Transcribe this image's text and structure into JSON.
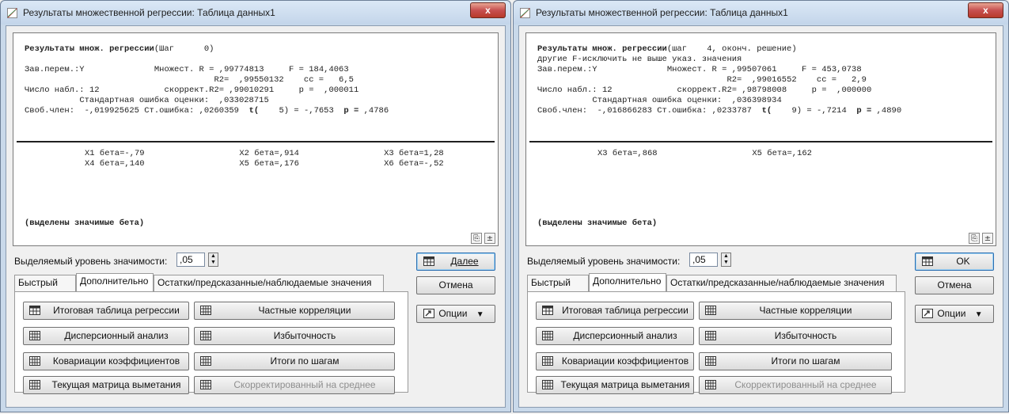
{
  "windows": [
    {
      "title": "Результаты множественной регрессии: Таблица данных1",
      "close_label": "x",
      "results": {
        "header_bold": "Результаты множ. регрессии",
        "header_rest": "(Шаг      0)",
        "header_line2": "",
        "dep_var_label": "Зав.перем.:Y",
        "mult_r_label": "Множест. R =",
        "mult_r_value": ",99774813",
        "f_label": "F =",
        "f_value": "184,4063",
        "r2_label": "R2=",
        "r2_value": ",99550132",
        "cc_label": "cc =",
        "cc_value": "6,5",
        "n_label": "Число набл.:",
        "n_value": "12",
        "adj_r2_label": "скоррект.R2=",
        "adj_r2_value": ",99010291",
        "p_label": "p =",
        "p_value": ",000011",
        "std_err_label": "Стандартная ошибка оценки:",
        "std_err_value": ",033028715",
        "intercept_label": "Своб.член:",
        "intercept_value": "-,019925625",
        "intercept_se_label": "Ст.ошибка:",
        "intercept_se_value": ",0260359",
        "t_label": "t(",
        "t_df": "5)",
        "t_value": "= -,7653",
        "t_p_label": "p =",
        "t_p_value": ",4786",
        "betas": [
          "X1 бета=-,79",
          "X2 бета=,914",
          "X3 бета=1,28",
          "X4 бета=,140",
          "X5 бета=,176",
          "X6 бета=-,52"
        ],
        "sig_note": "(выделены значимые бета)"
      },
      "level_label": "Выделяемый уровень значимости:",
      "level_value": ",05",
      "tabs": [
        "Быстрый",
        "Дополнительно",
        "Остатки/предсказанные/наблюдаемые значения"
      ],
      "buttons": [
        "Итоговая таблица регрессии",
        "Частные корреляции",
        "Дисперсионный анализ",
        "Избыточность",
        "Ковариации коэффициентов",
        "Итоги по шагам",
        "Текущая матрица выметания",
        "Скорректированный на среднее"
      ],
      "next_label": "Далее",
      "cancel_label": "Отмена",
      "options_label": "Опции"
    },
    {
      "title": "Результаты множественной регрессии: Таблица данных1",
      "close_label": "x",
      "results": {
        "header_bold": "Результаты множ. регрессии",
        "header_rest": "(шаг    4, оконч. решение)",
        "header_line2": "другие F-исключить не выше указ. значения",
        "dep_var_label": "Зав.перем.:Y",
        "mult_r_label": "Множест. R =",
        "mult_r_value": ",99507061",
        "f_label": "F =",
        "f_value": "453,0738",
        "r2_label": "R2=",
        "r2_value": ",99016552",
        "cc_label": "cc =",
        "cc_value": "2,9",
        "n_label": "Число набл.:",
        "n_value": "12",
        "adj_r2_label": "скоррект.R2=",
        "adj_r2_value": ",98798008",
        "p_label": "p =",
        "p_value": ",000000",
        "std_err_label": "Стандартная ошибка оценки:",
        "std_err_value": ",036398934",
        "intercept_label": "Своб.член:",
        "intercept_value": "-,016866283",
        "intercept_se_label": "Ст.ошибка:",
        "intercept_se_value": ",0233787",
        "t_label": "t(",
        "t_df": "9)",
        "t_value": "= -,7214",
        "t_p_label": "p =",
        "t_p_value": ",4890",
        "betas": [
          "X3 бета=,868",
          "X5 бета=,162"
        ],
        "sig_note": "(выделены значимые бета)"
      },
      "level_label": "Выделяемый уровень значимости:",
      "level_value": ",05",
      "tabs": [
        "Быстрый",
        "Дополнительно",
        "Остатки/предсказанные/наблюдаемые значения"
      ],
      "buttons": [
        "Итоговая таблица регрессии",
        "Частные корреляции",
        "Дисперсионный анализ",
        "Избыточность",
        "Ковариации коэффициентов",
        "Итоги по шагам",
        "Текущая матрица выметания",
        "Скорректированный на среднее"
      ],
      "next_label": "OK",
      "cancel_label": "Отмена",
      "options_label": "Опции"
    }
  ]
}
